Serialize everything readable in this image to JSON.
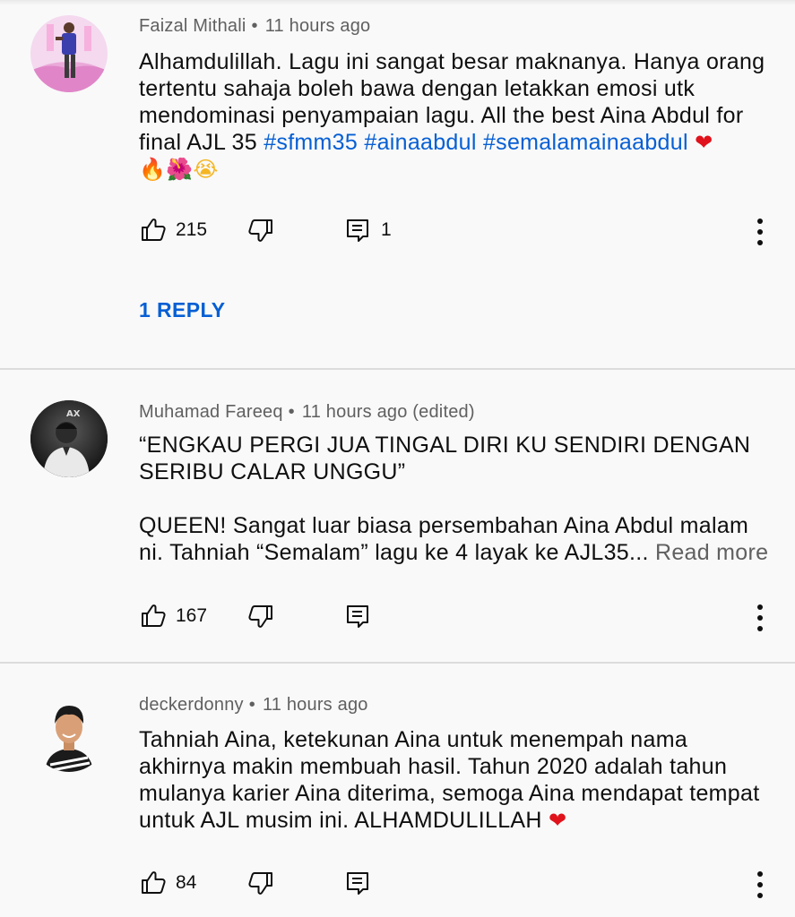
{
  "comments": [
    {
      "author": "Faizal Mithali",
      "time": "11 hours ago",
      "lines": [
        "Alhamdulillah. Lagu ini sangat besar maknanya. Hanya orang",
        "tertentu sahaja boleh bawa dengan letakkan emosi utk",
        "mendominasi penyampaian lagu. All the best Aina Abdul for"
      ],
      "line4_text": "final AJL 35 ",
      "hashtags": [
        "#sfmm35",
        "#ainaabdul",
        "#semalamainaabdul"
      ],
      "emojis": [
        "❤",
        "🔥",
        "🌺",
        "😭"
      ],
      "likes": "215",
      "replies_count": "1",
      "reply_link": "1 REPLY"
    },
    {
      "author": "Muhamad Fareeq",
      "time": "11 hours ago (edited)",
      "quote_lines": [
        "“ENGKAU PERGI JUA TINGAL DIRI KU SENDIRI DENGAN",
        "SERIBU CALAR UNGGU”"
      ],
      "lines": [
        "QUEEN! Sangat luar biasa persembahan Aina Abdul malam",
        "ni. Tahniah “Semalam” lagu ke 4 layak ke AJL35..."
      ],
      "read_more": "Read more",
      "likes": "167"
    },
    {
      "author": "deckerdonny",
      "time": "11 hours ago",
      "lines": [
        "Tahniah Aina, ketekunan Aina untuk menempah nama",
        "akhirnya makin membuah hasil. Tahun 2020 adalah tahun",
        "mulanya karier Aina diterima, semoga Aina mendapat tempat",
        "untuk AJL musim ini. ALHAMDULILLAH "
      ],
      "emoji": "❤",
      "likes": "84"
    }
  ],
  "separator": "•",
  "icons": {
    "like": "thumb-up-icon",
    "dislike": "thumb-down-icon",
    "reply": "comment-icon",
    "more": "more-vert-icon"
  },
  "colors": {
    "link": "#065fd4",
    "meta": "#606060",
    "text": "#0f0f0f",
    "heart": "#e0121b"
  }
}
